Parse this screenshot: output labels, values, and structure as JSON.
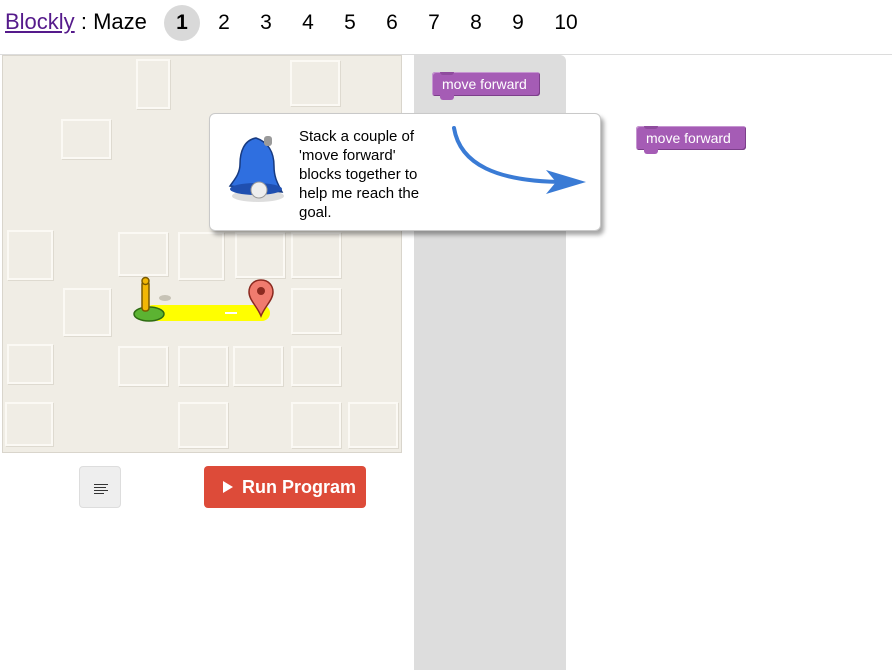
{
  "header": {
    "app_link": "Blockly",
    "separator": ":",
    "game_name": "Maze",
    "levels": [
      "1",
      "2",
      "3",
      "4",
      "5",
      "6",
      "7",
      "8",
      "9",
      "10"
    ],
    "current_level": "1"
  },
  "maze": {
    "start_icon": "pegman-start-icon",
    "goal_icon": "map-marker-goal-icon"
  },
  "controls": {
    "code_button_icon": "code-lines-icon",
    "run_label": "Run Program",
    "run_icon": "play-icon"
  },
  "toolbox": {
    "blocks": [
      "move forward"
    ]
  },
  "workspace": {
    "blocks": [
      "move forward"
    ]
  },
  "dialog": {
    "text": "Stack a couple of 'move forward' blocks together to help me reach the goal.",
    "icon": "bell-icon",
    "arrow_icon": "curved-arrow-icon"
  },
  "colors": {
    "block": "#a55cb5",
    "run_button": "#dd4b39",
    "path": "#ffff00",
    "arrow": "#3a7bd5",
    "bell": "#2f6fe0"
  }
}
